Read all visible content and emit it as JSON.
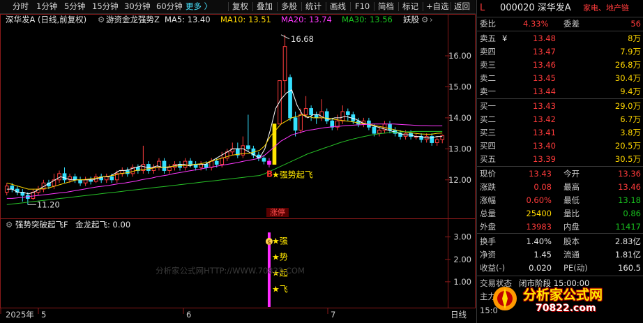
{
  "toolbar": {
    "items": [
      "分时",
      "1分钟",
      "5分钟",
      "15分钟",
      "30分钟",
      "60分钟",
      "更多",
      "复权",
      "叠加",
      "多股",
      "统计",
      "画线",
      "F10",
      "简档",
      "标记",
      "+自选",
      "返回"
    ],
    "more_arrow": "〉"
  },
  "chart": {
    "title": "深华发A (日线,前复权)",
    "indicator_name": "游资金龙强势Z",
    "ma5": "MA5: 13.40",
    "ma10": "MA10: 13.51",
    "ma20": "MA20: 13.74",
    "ma30": "MA30: 13.56",
    "board": "妖股",
    "y_ticks": [
      "16.00",
      "15.00",
      "14.00",
      "13.00",
      "12.00"
    ],
    "high_label": "16.68",
    "low_label": "11.20",
    "signal_b": "B",
    "signal_text": "★强势起飞",
    "limit_up": "涨停",
    "sub_title": "强势突破起飞F",
    "sub_value": "金龙起飞: 0.00",
    "sub_y_ticks": [
      "3.00",
      "2.00",
      "1.00"
    ],
    "sub_chars": [
      "★强",
      "★势",
      "★起",
      "★飞"
    ],
    "sub_badge": "$",
    "watermark": "分析家公式网HTTP://WWW.70822.COM",
    "x_labels": [
      "2025年",
      "5",
      "6",
      "7"
    ],
    "period": "日线",
    "candles": [
      {
        "o": 11.6,
        "c": 11.8,
        "h": 11.9,
        "l": 11.5
      },
      {
        "o": 11.8,
        "c": 11.7,
        "h": 11.9,
        "l": 11.6
      },
      {
        "o": 11.7,
        "c": 11.6,
        "h": 11.8,
        "l": 11.5
      },
      {
        "o": 11.6,
        "c": 11.5,
        "h": 11.7,
        "l": 11.3
      },
      {
        "o": 11.5,
        "c": 11.4,
        "h": 11.6,
        "l": 11.2
      },
      {
        "o": 11.4,
        "c": 11.6,
        "h": 11.7,
        "l": 11.35
      },
      {
        "o": 11.6,
        "c": 11.7,
        "h": 11.8,
        "l": 11.5
      },
      {
        "o": 11.7,
        "c": 11.9,
        "h": 12.0,
        "l": 11.6
      },
      {
        "o": 11.9,
        "c": 11.8,
        "h": 12.0,
        "l": 11.7
      },
      {
        "o": 11.8,
        "c": 12.0,
        "h": 12.2,
        "l": 11.7
      },
      {
        "o": 12.0,
        "c": 12.2,
        "h": 12.3,
        "l": 11.9
      },
      {
        "o": 12.2,
        "c": 12.0,
        "h": 12.4,
        "l": 11.9
      },
      {
        "o": 12.0,
        "c": 12.1,
        "h": 12.2,
        "l": 11.9
      },
      {
        "o": 12.1,
        "c": 12.0,
        "h": 12.2,
        "l": 11.9
      },
      {
        "o": 12.0,
        "c": 11.9,
        "h": 12.1,
        "l": 11.8
      },
      {
        "o": 11.9,
        "c": 12.0,
        "h": 12.1,
        "l": 11.8
      },
      {
        "o": 12.0,
        "c": 11.95,
        "h": 12.1,
        "l": 11.85
      },
      {
        "o": 11.95,
        "c": 12.1,
        "h": 12.2,
        "l": 11.9
      },
      {
        "o": 12.1,
        "c": 12.0,
        "h": 12.2,
        "l": 11.9
      },
      {
        "o": 12.0,
        "c": 12.1,
        "h": 12.2,
        "l": 11.9
      },
      {
        "o": 12.1,
        "c": 12.0,
        "h": 12.2,
        "l": 11.9
      },
      {
        "o": 12.0,
        "c": 12.2,
        "h": 12.3,
        "l": 11.9
      },
      {
        "o": 12.2,
        "c": 12.3,
        "h": 12.4,
        "l": 12.1
      },
      {
        "o": 12.3,
        "c": 12.2,
        "h": 12.4,
        "l": 12.1
      },
      {
        "o": 12.2,
        "c": 12.4,
        "h": 12.5,
        "l": 12.1
      },
      {
        "o": 12.4,
        "c": 12.3,
        "h": 12.5,
        "l": 12.2
      },
      {
        "o": 12.3,
        "c": 12.5,
        "h": 13.1,
        "l": 12.2
      },
      {
        "o": 12.5,
        "c": 12.3,
        "h": 12.6,
        "l": 12.2
      },
      {
        "o": 12.3,
        "c": 12.4,
        "h": 12.5,
        "l": 12.2
      },
      {
        "o": 12.4,
        "c": 12.6,
        "h": 12.7,
        "l": 12.3
      },
      {
        "o": 12.6,
        "c": 12.3,
        "h": 12.7,
        "l": 12.2
      },
      {
        "o": 12.3,
        "c": 12.4,
        "h": 12.5,
        "l": 12.2
      },
      {
        "o": 12.4,
        "c": 12.5,
        "h": 12.6,
        "l": 12.3
      },
      {
        "o": 12.5,
        "c": 12.4,
        "h": 12.6,
        "l": 12.3
      },
      {
        "o": 12.4,
        "c": 12.6,
        "h": 12.7,
        "l": 12.3
      },
      {
        "o": 12.6,
        "c": 12.5,
        "h": 12.7,
        "l": 12.4
      },
      {
        "o": 12.5,
        "c": 12.4,
        "h": 12.6,
        "l": 12.3
      },
      {
        "o": 12.4,
        "c": 12.5,
        "h": 12.6,
        "l": 12.3
      },
      {
        "o": 12.5,
        "c": 12.4,
        "h": 12.6,
        "l": 12.3
      },
      {
        "o": 12.4,
        "c": 12.6,
        "h": 12.7,
        "l": 12.3
      },
      {
        "o": 12.6,
        "c": 12.5,
        "h": 12.7,
        "l": 12.4
      },
      {
        "o": 12.5,
        "c": 12.7,
        "h": 12.9,
        "l": 12.4
      },
      {
        "o": 12.7,
        "c": 12.9,
        "h": 13.0,
        "l": 12.6
      },
      {
        "o": 12.9,
        "c": 13.0,
        "h": 13.2,
        "l": 12.8
      },
      {
        "o": 13.0,
        "c": 12.8,
        "h": 13.2,
        "l": 12.7
      },
      {
        "o": 12.8,
        "c": 13.1,
        "h": 13.4,
        "l": 12.7
      },
      {
        "o": 13.1,
        "c": 13.0,
        "h": 14.1,
        "l": 12.9
      },
      {
        "o": 13.0,
        "c": 12.8,
        "h": 13.1,
        "l": 12.7
      },
      {
        "o": 12.8,
        "c": 12.7,
        "h": 12.9,
        "l": 12.6
      },
      {
        "o": 12.7,
        "c": 12.6,
        "h": 12.8,
        "l": 12.5
      },
      {
        "o": 12.6,
        "c": 12.5,
        "h": 12.7,
        "l": 12.4
      },
      {
        "o": 12.5,
        "c": 13.8,
        "h": 13.8,
        "l": 12.5
      },
      {
        "o": 13.8,
        "c": 15.2,
        "h": 15.2,
        "l": 13.8
      },
      {
        "o": 15.2,
        "c": 16.3,
        "h": 16.68,
        "l": 14.8
      },
      {
        "o": 15.3,
        "c": 14.0,
        "h": 15.4,
        "l": 13.9
      },
      {
        "o": 14.0,
        "c": 13.6,
        "h": 14.2,
        "l": 13.4
      },
      {
        "o": 13.6,
        "c": 14.1,
        "h": 14.3,
        "l": 13.5
      },
      {
        "o": 14.1,
        "c": 14.3,
        "h": 14.7,
        "l": 14.0
      },
      {
        "o": 14.3,
        "c": 14.1,
        "h": 14.4,
        "l": 13.9
      },
      {
        "o": 14.1,
        "c": 14.0,
        "h": 14.2,
        "l": 13.8
      },
      {
        "o": 14.0,
        "c": 14.2,
        "h": 14.6,
        "l": 13.9
      },
      {
        "o": 14.2,
        "c": 13.9,
        "h": 14.3,
        "l": 13.8
      },
      {
        "o": 13.9,
        "c": 13.7,
        "h": 14.0,
        "l": 13.6
      },
      {
        "o": 13.7,
        "c": 13.9,
        "h": 14.1,
        "l": 13.6
      },
      {
        "o": 13.9,
        "c": 14.2,
        "h": 14.4,
        "l": 13.8
      },
      {
        "o": 14.2,
        "c": 14.1,
        "h": 14.3,
        "l": 13.9
      },
      {
        "o": 14.1,
        "c": 13.9,
        "h": 14.2,
        "l": 13.8
      },
      {
        "o": 13.9,
        "c": 13.8,
        "h": 14.0,
        "l": 13.7
      },
      {
        "o": 13.8,
        "c": 13.9,
        "h": 14.0,
        "l": 13.7
      },
      {
        "o": 13.9,
        "c": 13.7,
        "h": 14.0,
        "l": 13.6
      },
      {
        "o": 13.7,
        "c": 13.5,
        "h": 13.8,
        "l": 13.4
      },
      {
        "o": 13.5,
        "c": 13.6,
        "h": 13.7,
        "l": 13.4
      },
      {
        "o": 13.6,
        "c": 13.8,
        "h": 13.9,
        "l": 13.5
      },
      {
        "o": 13.8,
        "c": 13.6,
        "h": 13.9,
        "l": 13.5
      },
      {
        "o": 13.6,
        "c": 13.5,
        "h": 13.7,
        "l": 13.4
      },
      {
        "o": 13.5,
        "c": 13.4,
        "h": 13.6,
        "l": 13.3
      },
      {
        "o": 13.4,
        "c": 13.5,
        "h": 13.6,
        "l": 13.3
      },
      {
        "o": 13.5,
        "c": 13.4,
        "h": 13.6,
        "l": 13.3
      },
      {
        "o": 13.4,
        "c": 13.4,
        "h": 13.5,
        "l": 13.3
      },
      {
        "o": 13.4,
        "c": 13.3,
        "h": 13.5,
        "l": 13.2
      },
      {
        "o": 13.3,
        "c": 13.4,
        "h": 13.5,
        "l": 13.2
      },
      {
        "o": 13.4,
        "c": 13.2,
        "h": 13.5,
        "l": 13.1
      },
      {
        "o": 13.2,
        "c": 13.3,
        "h": 13.4,
        "l": 13.1
      },
      {
        "o": 13.3,
        "c": 13.43,
        "h": 13.46,
        "l": 13.18
      }
    ],
    "ma_series": {
      "ma5": [
        11.7,
        11.7,
        11.6,
        11.6,
        11.55,
        11.6,
        11.7,
        11.8,
        11.9,
        12.0,
        12.1,
        12.05,
        12.0,
        12.0,
        12.0,
        12.0,
        12.0,
        12.05,
        12.1,
        12.1,
        12.2,
        12.3,
        12.3,
        12.35,
        12.4,
        12.45,
        12.4,
        12.4,
        12.45,
        12.4,
        12.4,
        12.45,
        12.5,
        12.5,
        12.45,
        12.5,
        12.5,
        12.5,
        12.6,
        12.7,
        12.8,
        12.9,
        13.0,
        13.0,
        13.0,
        12.9,
        12.8,
        12.7,
        13.0,
        13.6,
        14.3,
        14.6,
        14.8,
        14.9,
        14.4,
        14.1,
        14.0,
        14.1,
        14.1,
        14.0,
        13.95,
        14.0,
        14.0,
        14.05,
        14.0,
        13.95,
        13.85,
        13.8,
        13.75,
        13.7,
        13.65,
        13.6,
        13.55,
        13.5,
        13.45,
        13.45,
        13.4,
        13.4,
        13.35,
        13.35,
        13.4,
        13.4
      ],
      "ma10": [
        11.9,
        11.85,
        11.8,
        11.75,
        11.7,
        11.7,
        11.7,
        11.72,
        11.75,
        11.8,
        11.85,
        11.9,
        11.95,
        12.0,
        12.0,
        12.02,
        12.05,
        12.07,
        12.1,
        12.12,
        12.15,
        12.2,
        12.22,
        12.25,
        12.3,
        12.32,
        12.35,
        12.37,
        12.4,
        12.4,
        12.42,
        12.44,
        12.45,
        12.46,
        12.48,
        12.5,
        12.52,
        12.55,
        12.6,
        12.65,
        12.7,
        12.75,
        12.8,
        12.82,
        12.85,
        12.85,
        12.9,
        12.95,
        13.1,
        13.4,
        13.6,
        13.8,
        13.9,
        14.0,
        14.05,
        14.1,
        14.05,
        14.0,
        14.0,
        14.0,
        13.98,
        13.95,
        13.92,
        13.9,
        13.88,
        13.85,
        13.82,
        13.8,
        13.77,
        13.73,
        13.7,
        13.66,
        13.62,
        13.58,
        13.55,
        13.52,
        13.5,
        13.48,
        13.47,
        13.47,
        13.5,
        13.51
      ],
      "ma20": [
        11.4,
        11.4,
        11.42,
        11.44,
        11.46,
        11.48,
        11.5,
        11.52,
        11.54,
        11.56,
        11.58,
        11.6,
        11.63,
        11.66,
        11.69,
        11.72,
        11.75,
        11.78,
        11.8,
        11.82,
        11.85,
        11.88,
        11.9,
        11.93,
        11.96,
        12.0,
        12.03,
        12.06,
        12.1,
        12.13,
        12.16,
        12.2,
        12.23,
        12.26,
        12.29,
        12.32,
        12.35,
        12.38,
        12.41,
        12.44,
        12.47,
        12.5,
        12.53,
        12.56,
        12.6,
        12.63,
        12.66,
        12.7,
        12.8,
        12.95,
        13.1,
        13.25,
        13.35,
        13.45,
        13.5,
        13.55,
        13.6,
        13.62,
        13.65,
        13.68,
        13.7,
        13.72,
        13.73,
        13.75,
        13.76,
        13.77,
        13.78,
        13.79,
        13.8,
        13.8,
        13.8,
        13.8,
        13.8,
        13.79,
        13.78,
        13.77,
        13.76,
        13.75,
        13.75,
        13.74,
        13.74,
        13.74
      ],
      "ma30": [
        11.2,
        11.22,
        11.24,
        11.26,
        11.28,
        11.3,
        11.32,
        11.34,
        11.36,
        11.38,
        11.4,
        11.42,
        11.44,
        11.46,
        11.48,
        11.5,
        11.52,
        11.54,
        11.56,
        11.58,
        11.6,
        11.62,
        11.64,
        11.66,
        11.68,
        11.7,
        11.72,
        11.74,
        11.76,
        11.78,
        11.8,
        11.82,
        11.84,
        11.86,
        11.88,
        11.9,
        11.92,
        11.94,
        11.96,
        11.98,
        12.0,
        12.02,
        12.04,
        12.06,
        12.08,
        12.1,
        12.12,
        12.14,
        12.2,
        12.28,
        12.36,
        12.44,
        12.52,
        12.6,
        12.68,
        12.76,
        12.84,
        12.9,
        12.96,
        13.02,
        13.08,
        13.14,
        13.2,
        13.25,
        13.3,
        13.34,
        13.38,
        13.42,
        13.45,
        13.48,
        13.5,
        13.52,
        13.53,
        13.54,
        13.55,
        13.55,
        13.56,
        13.56,
        13.56,
        13.56,
        13.56,
        13.56
      ]
    }
  },
  "panel": {
    "label_l": "L",
    "code": "000020 深华发A",
    "sector": "家电、地产链",
    "weibi_label": "委比",
    "weibi": "4.33%",
    "weicha_label": "委差",
    "weicha": "56",
    "asks": [
      {
        "label": "卖五",
        "price": "13.48",
        "vol": "8万",
        "mark": "¥"
      },
      {
        "label": "卖四",
        "price": "13.47",
        "vol": "7.9万",
        "mark": ""
      },
      {
        "label": "卖三",
        "price": "13.46",
        "vol": "26.8万",
        "mark": ""
      },
      {
        "label": "卖二",
        "price": "13.45",
        "vol": "30.4万",
        "mark": ""
      },
      {
        "label": "卖一",
        "price": "13.44",
        "vol": "9.4万",
        "mark": ""
      }
    ],
    "bids": [
      {
        "label": "买一",
        "price": "13.43",
        "vol": "29.0万"
      },
      {
        "label": "买二",
        "price": "13.42",
        "vol": "6.7万"
      },
      {
        "label": "买三",
        "price": "13.41",
        "vol": "3.8万"
      },
      {
        "label": "买四",
        "price": "13.40",
        "vol": "20.5万"
      },
      {
        "label": "买五",
        "price": "13.39",
        "vol": "30.5万"
      }
    ],
    "stats": [
      {
        "l1": "现价",
        "v1": "13.43",
        "c1": "red",
        "l2": "今开",
        "v2": "13.36",
        "c2": "red"
      },
      {
        "l1": "涨跌",
        "v1": "0.08",
        "c1": "red",
        "l2": "最高",
        "v2": "13.46",
        "c2": "red"
      },
      {
        "l1": "涨幅",
        "v1": "0.60%",
        "c1": "red",
        "l2": "最低",
        "v2": "13.18",
        "c2": "green"
      },
      {
        "l1": "总量",
        "v1": "25400",
        "c1": "yellow",
        "l2": "量比",
        "v2": "0.86",
        "c2": "green"
      },
      {
        "l1": "外盘",
        "v1": "13983",
        "c1": "red",
        "l2": "内盘",
        "v2": "11417",
        "c2": "green"
      }
    ],
    "stats2": [
      {
        "l1": "换手",
        "v1": "1.40%",
        "l2": "股本",
        "v2": "2.83亿"
      },
      {
        "l1": "净资",
        "v1": "1.45",
        "l2": "流通",
        "v2": "1.81亿"
      },
      {
        "l1": "收益(-)",
        "v1": "0.020",
        "l2": "PE(动)",
        "v2": "160.5"
      }
    ],
    "trade_label": "交易状态",
    "trade_value": "闭市阶段 15:00:00",
    "main_label": "主力",
    "time_label": "15:0",
    "brand": "分析家公式网",
    "brand_url": "70822.com"
  }
}
